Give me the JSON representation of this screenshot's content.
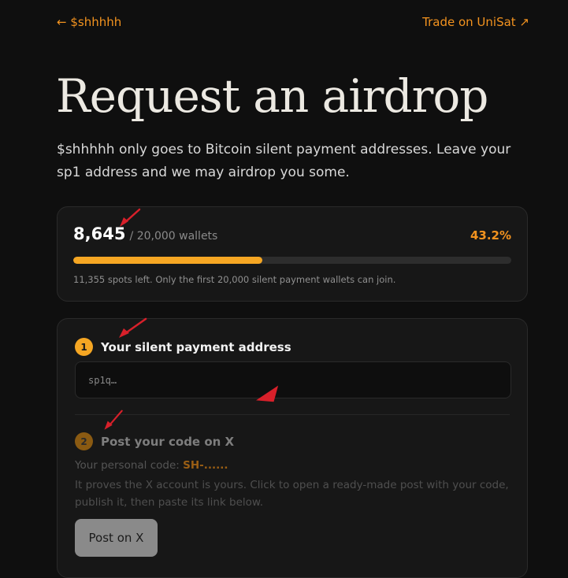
{
  "nav": {
    "back_label": "← $shhhhh",
    "trade_label": "Trade on UniSat ↗"
  },
  "hero": {
    "title": "Request an airdrop",
    "lead": "$shhhhh only goes to Bitcoin silent payment addresses. Leave your sp1 address and we may airdrop you some."
  },
  "counter": {
    "count": "8,645",
    "total": "/ 20,000 wallets",
    "percent": "43.2%",
    "progress_fraction": 0.432,
    "spots_text": "11,355 spots left. Only the first 20,000 silent payment wallets can join."
  },
  "step1": {
    "number": "1",
    "title": "Your silent payment address",
    "placeholder": "sp1q…"
  },
  "step2": {
    "number": "2",
    "title": "Post your code on X",
    "code_label": "Your personal code: ",
    "code_value": "SH-......",
    "proves": "It proves the X account is yours. Click to open a ready-made post with your code, publish it, then paste its link below.",
    "button_label": "Post on X"
  },
  "colors": {
    "accent": "#f3931f",
    "progress_fill": "#f5a623",
    "annotation_arrow": "#d8202a"
  }
}
